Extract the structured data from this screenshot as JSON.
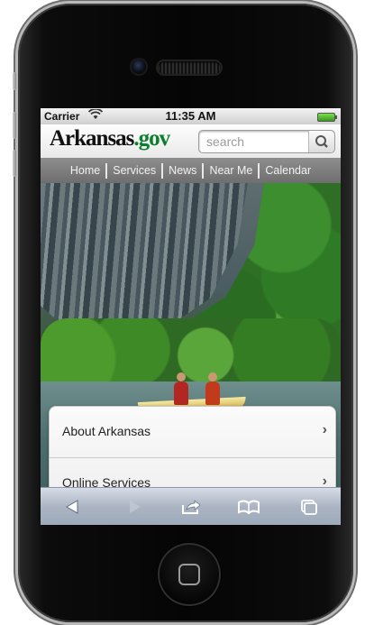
{
  "status_bar": {
    "carrier": "Carrier",
    "time": "11:35 AM"
  },
  "header": {
    "logo_main": "Arkansas",
    "logo_tld": ".gov"
  },
  "search": {
    "placeholder": "search"
  },
  "nav": [
    "Home",
    "Services",
    "News",
    "Near Me",
    "Calendar"
  ],
  "menu": [
    "About Arkansas",
    "Online Services"
  ],
  "icons": {
    "wifi": "wifi-icon",
    "battery": "battery-icon",
    "search": "magnifier-icon",
    "back": "back-arrow-icon",
    "forward": "forward-arrow-icon",
    "share": "share-icon",
    "bookmarks": "bookmarks-book-icon",
    "tabs": "tabs-icon",
    "chevron": "chevron-right-icon"
  },
  "colors": {
    "logo_green": "#0b7f2e",
    "nav_bg": "#7b7b7b",
    "toolbar_bg": "#aab4c3"
  }
}
